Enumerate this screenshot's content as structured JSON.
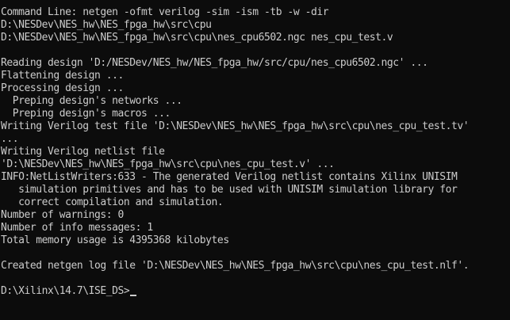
{
  "console": {
    "lines": [
      "",
      "Command Line: netgen -ofmt verilog -sim -ism -tb -w -dir",
      "D:\\NESDev\\NES_hw\\NES_fpga_hw\\src\\cpu",
      "D:\\NESDev\\NES_hw\\NES_fpga_hw\\src\\cpu\\nes_cpu6502.ngc nes_cpu_test.v",
      "",
      "Reading design 'D:/NESDev/NES_hw/NES_fpga_hw/src/cpu/nes_cpu6502.ngc' ...",
      "Flattening design ...",
      "Processing design ...",
      "  Preping design's networks ...",
      "  Preping design's macros ...",
      "Writing Verilog test file 'D:\\NESDev\\NES_hw\\NES_fpga_hw\\src\\cpu\\nes_cpu_test.tv'",
      "...",
      "Writing Verilog netlist file",
      "'D:\\NESDev\\NES_hw\\NES_fpga_hw\\src\\cpu\\nes_cpu_test.v' ...",
      "INFO:NetListWriters:633 - The generated Verilog netlist contains Xilinx UNISIM",
      "   simulation primitives and has to be used with UNISIM simulation library for",
      "   correct compilation and simulation.",
      "Number of warnings: 0",
      "Number of info messages: 1",
      "Total memory usage is 4395368 kilobytes",
      "",
      "Created netgen log file 'D:\\NESDev\\NES_hw\\NES_fpga_hw\\src\\cpu\\nes_cpu_test.nlf'.",
      ""
    ],
    "prompt": "D:\\Xilinx\\14.7\\ISE_DS>"
  },
  "colors": {
    "background": "#0c0c0c",
    "foreground": "#cccccc"
  }
}
